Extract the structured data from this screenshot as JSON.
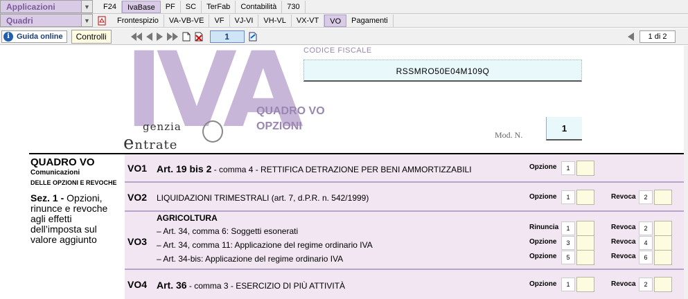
{
  "menubar": {
    "applicazioni": "Applicazioni",
    "quadri": "Quadri",
    "tabs1": [
      "F24",
      "IvaBase",
      "PF",
      "SC",
      "TerFab",
      "Contabilità",
      "730"
    ],
    "tabs2": [
      "Frontespizio",
      "VA-VB-VE",
      "VF",
      "VJ-VI",
      "VH-VL",
      "VX-VT",
      "VO",
      "Pagamenti"
    ]
  },
  "toolbar": {
    "guida": "Guida online",
    "controlli": "Controlli",
    "page": "1",
    "pager": "1 di 2"
  },
  "doc": {
    "cf_label": "CODICE FISCALE",
    "cf_value": "RSSMRO50E04M109Q",
    "logo_letters": "IVA",
    "agenzia1": "genzia",
    "agenzia2": "ntrate",
    "quadro_title": "QUADRO VO",
    "quadro_sub": "OPZIONI",
    "modn_label": "Mod. N.",
    "modn_value": "1",
    "left_t1": "QUADRO VO",
    "left_t2a": "Comunicazioni",
    "left_t2b": "delle opzioni e revoche",
    "left_sez": "Sez. 1 -",
    "left_t3": "Opzioni, rinunce e revoche agli effetti dell’imposta sul valore aggiunto"
  },
  "rows": {
    "vo1": {
      "code": "VO1",
      "bold": "Art. 19 bis 2",
      "text": " - comma 4 - RETTIFICA DETRAZIONE PER BENI AMMORTIZZABILI",
      "opzione": "Opzione",
      "n1": "1"
    },
    "vo2": {
      "code": "VO2",
      "text": "LIQUIDAZIONI TRIMESTRALI  (art. 7, d.P.R. n. 542/1999)",
      "opzione": "Opzione",
      "n1": "1",
      "revoca": "Revoca",
      "n2": "2"
    },
    "vo3": {
      "code": "VO3",
      "head": "AGRICOLTURA",
      "l1": "– Art. 34, comma   6: Soggetti esonerati",
      "l2": "– Art. 34, comma 11: Applicazione del regime ordinario IVA",
      "l3": "– Art. 34-bis: Applicazione del regime ordinario IVA",
      "rinuncia": "Rinuncia",
      "opzione": "Opzione",
      "revoca": "Revoca",
      "n": [
        "1",
        "2",
        "3",
        "4",
        "5",
        "6"
      ]
    },
    "vo4": {
      "code": "VO4",
      "bold": "Art. 36",
      "text": " - comma 3 - ESERCIZIO DI PIÙ ATTIVITÀ",
      "opzione": "Opzione",
      "n1": "1",
      "revoca": "Revoca",
      "n2": "2"
    }
  }
}
